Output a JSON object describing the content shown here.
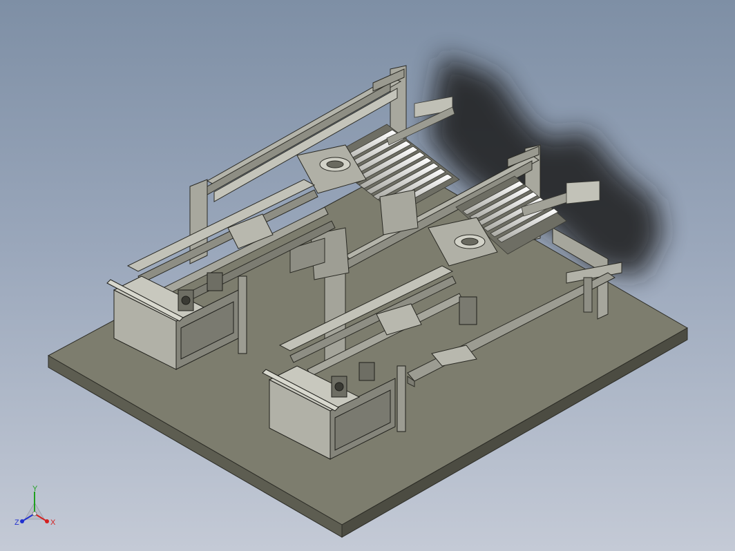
{
  "view": {
    "background_top": "#7e8fa5",
    "background_bottom": "#c4cad6",
    "base_plate_color": "#7b7b6c",
    "frame_color": "#a9a9a0",
    "roller_color": "#e6e6e0",
    "shadow_color": "#1e1e1e"
  },
  "triad": {
    "x_label": "X",
    "y_label": "Y",
    "z_label": "Z",
    "x_color": "#d42020",
    "y_color": "#20a020",
    "z_color": "#2030d0"
  }
}
